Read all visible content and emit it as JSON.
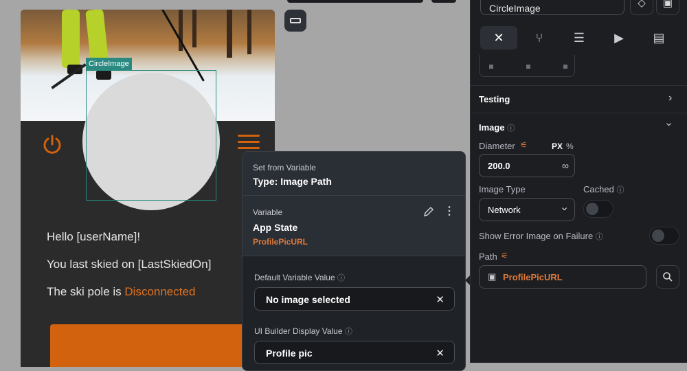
{
  "phone": {
    "circle_tag": "CircleImage",
    "greeting": "Hello [userName]!",
    "last_skied": "You last skied on [LastSkiedOn]",
    "pole_prefix": "The ski pole is ",
    "pole_status": "Disconnected"
  },
  "popup": {
    "header_label": "Set from Variable",
    "header_type": "Type: Image Path",
    "variable_label": "Variable",
    "variable_source": "App State",
    "variable_name": "ProfilePicURL",
    "default_label": "Default Variable Value",
    "default_value": "No image selected",
    "ui_label": "UI Builder Display Value",
    "ui_value": "Profile pic"
  },
  "panel": {
    "widget_name": "CircleImage",
    "testing": "Testing",
    "image_section": "Image",
    "diameter_label": "Diameter",
    "unit_px": "PX",
    "unit_pct": "%",
    "diameter_value": "200.0",
    "infinity": "∞",
    "image_type_label": "Image Type",
    "image_type_value": "Network",
    "cached_label": "Cached",
    "show_error_label": "Show Error Image on Failure",
    "path_label": "Path",
    "path_value": "ProfilePicURL"
  },
  "colors": {
    "accent_orange": "#d2620e",
    "selection_teal": "#2a8a82",
    "panel_bg": "#1c1e22"
  }
}
